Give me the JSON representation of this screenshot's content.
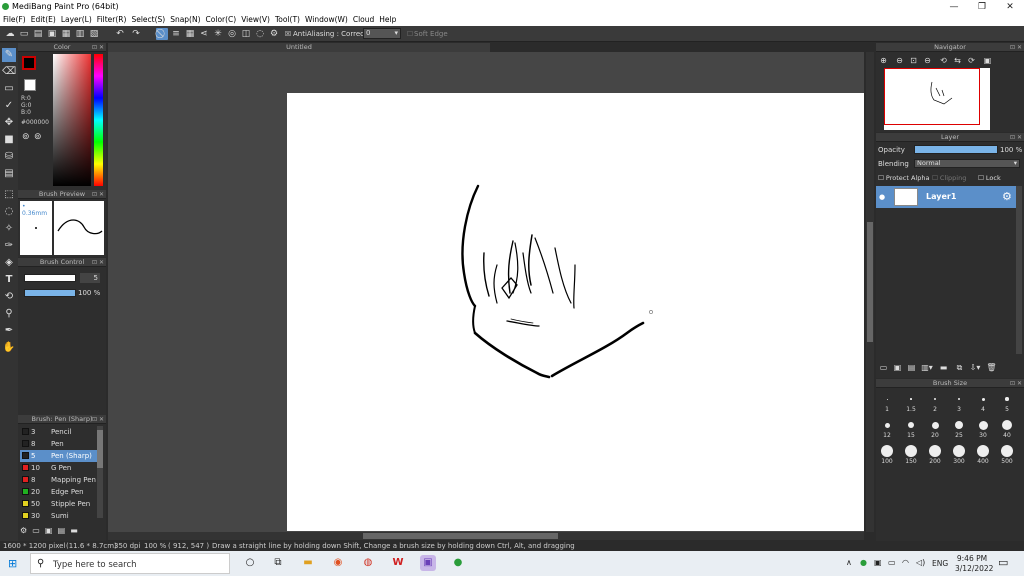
{
  "window": {
    "title": "MediBang Paint Pro (64bit)"
  },
  "menu": [
    "File(F)",
    "Edit(E)",
    "Layer(L)",
    "Filter(R)",
    "Select(S)",
    "Snap(N)",
    "Color(C)",
    "View(V)",
    "Tool(T)",
    "Window(W)",
    "Cloud",
    "Help"
  ],
  "toolbar": {
    "antialias_label": "AntiAliasing",
    "correction_label": "Correction",
    "correction_value": "0",
    "soft_edge_label": "Soft Edge"
  },
  "document": {
    "tab_title": "Untitled"
  },
  "color_panel": {
    "title": "Color",
    "r": "R:0",
    "g": "G:0",
    "b": "B:0",
    "hex": "#000000"
  },
  "brush_preview": {
    "title": "Brush Preview",
    "size": "0.36mm"
  },
  "brush_control": {
    "title": "Brush Control",
    "size_value": "5",
    "opacity_value": "100",
    "opacity_unit": "%"
  },
  "brush_list": {
    "title": "Brush: Pen (Sharp)",
    "items": [
      {
        "num": "3",
        "name": "Pencil",
        "color": "#222222"
      },
      {
        "num": "8",
        "name": "Pen",
        "color": "#222222"
      },
      {
        "num": "5",
        "name": "Pen (Sharp)",
        "color": "#222222",
        "selected": true
      },
      {
        "num": "10",
        "name": "G Pen",
        "color": "#e02020"
      },
      {
        "num": "8",
        "name": "Mapping Pen",
        "color": "#e02020"
      },
      {
        "num": "20",
        "name": "Edge Pen",
        "color": "#20b020"
      },
      {
        "num": "50",
        "name": "Stipple Pen",
        "color": "#e0d020"
      },
      {
        "num": "30",
        "name": "Sumi",
        "color": "#e0d020"
      }
    ]
  },
  "navigator": {
    "title": "Navigator"
  },
  "layer_panel": {
    "title": "Layer",
    "opacity_label": "Opacity",
    "opacity_value": "100",
    "opacity_unit": "%",
    "blending_label": "Blending",
    "blending_value": "Normal",
    "protect_alpha": "Protect Alpha",
    "clipping": "Clipping",
    "lock": "Lock",
    "layers": [
      {
        "name": "Layer1"
      }
    ]
  },
  "brush_size": {
    "title": "Brush Size",
    "sizes": [
      "1",
      "1.5",
      "2",
      "3",
      "4",
      "5",
      "12",
      "15",
      "20",
      "25",
      "30",
      "40",
      "100",
      "150",
      "200",
      "300",
      "400",
      "500"
    ]
  },
  "status": {
    "dimensions": "1600 * 1200 pixel",
    "physical": "(11.6 * 8.7cm)",
    "dpi": "350 dpi",
    "zoom": "100 %",
    "coords": "( 912, 547 )",
    "hint": "Draw a straight line by holding down Shift, Change a brush size by holding down Ctrl, Alt, and dragging"
  },
  "taskbar": {
    "search_placeholder": "Type here to search",
    "lang": "ENG",
    "time": "9:46 PM",
    "date": "3/12/2022"
  },
  "colors": {
    "accent": "#5b8fc9"
  }
}
